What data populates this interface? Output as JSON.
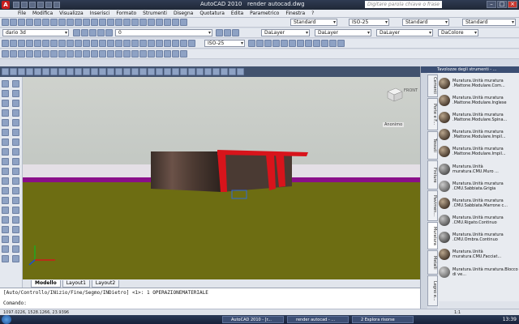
{
  "title_bar": {
    "app_title": "AutoCAD 2010",
    "document": "render autocad.dwg",
    "search_placeholder": "Digitare parola chiave o frase"
  },
  "menu": [
    "File",
    "Modifica",
    "Visualizza",
    "Inserisci",
    "Formato",
    "Strumenti",
    "Disegna",
    "Quotatura",
    "Edita",
    "Parametrico",
    "Finestra",
    "?"
  ],
  "toolbars": {
    "text_style": "Standard",
    "dim_style": "ISO-25",
    "table_style": "Standard",
    "mleader_style": "Standard",
    "workspace": "dario 3d",
    "layer": "0",
    "dim_style_2": "ISO-25",
    "color": "DaLayer",
    "linetype": "DaLayer",
    "lineweight": "DaLayer",
    "plot_style": "DaColore"
  },
  "viewport": {
    "viewcube_label": "FRONT",
    "ucs_label": "Anonimo",
    "sky_color": "#c9cdc9",
    "ground_color": "#6d6d12",
    "accent_color": "#d8141b"
  },
  "layout_tabs": [
    "Modello",
    "Layout1",
    "Layout2"
  ],
  "command": {
    "history": "[Auto/Controllo/INizio/Fine/Segmo/INDietro] <1>: 1 OPERAZIONEMATERIALE",
    "prompt": "Comando:"
  },
  "status": {
    "coords": "1097.0226, 1528.1266, 23.9396",
    "scale": "1:1"
  },
  "palette": {
    "title": "Tavolozze degli strumenti - ...",
    "tabs": [
      "Cementi",
      "Porte e F...",
      "Tessuti",
      "Finiture",
      "Pavimen...",
      "Muratura",
      "Metalli",
      "Legno e..."
    ],
    "active_tab": "Muratura",
    "items": [
      "Muratura.Unità muratura .Mattone.Modulare.Com...",
      "Muratura.Unità muratura .Mattone.Modulare.Inglese",
      "Muratura.Unità muratura .Mattone.Modulare.Spina...",
      "Muratura.Unità muratura .Mattone.Modulare.Impil...",
      "Muratura.Unità muratura .Mattone.Modulare.Impil...",
      "Muratura.Unità muratura.CMU.Muro ...",
      "Muratura.Unità muratura .CMU.Sabbiata.Grigia",
      "Muratura.Unità muratura .CMU.Sabbiata.Marrone c...",
      "Muratura.Unità muratura .CMU.Rigato.Continuo",
      "Muratura.Unità muratura .CMU.Ombra.Continuo",
      "Muratura.Unità muratura.CMU.Facciat...",
      "Muratura.Unità muratura.Blocco di ve..."
    ]
  },
  "taskbar": {
    "tasks": [
      "AutoCAD 2010 - [r...",
      "render autocad - ...",
      "2 Esplora risorse"
    ],
    "clock": "13:39"
  }
}
